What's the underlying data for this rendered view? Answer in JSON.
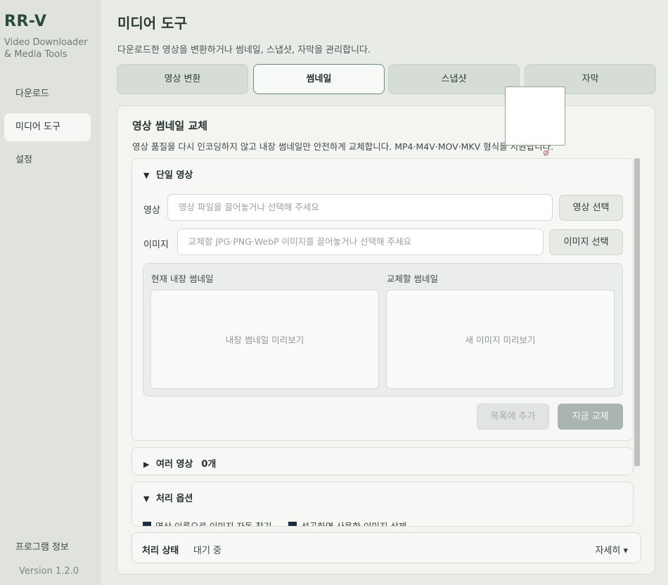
{
  "sidebar": {
    "brand": "RR-V",
    "subtitle_line1": "Video Downloader",
    "subtitle_line2": "& Media Tools",
    "items": [
      {
        "label": "다운로드"
      },
      {
        "label": "미디어 도구"
      },
      {
        "label": "설정"
      }
    ],
    "info": "프로그램 정보",
    "version": "Version 1.2.0"
  },
  "header": {
    "title": "미디어 도구",
    "description": "다운로드한 영상을 변환하거나 썸네일, 스냅샷, 자막을 관리합니다."
  },
  "tabs": [
    {
      "label": "영상 변환"
    },
    {
      "label": "썸네일"
    },
    {
      "label": "스냅샷"
    },
    {
      "label": "자막"
    }
  ],
  "panel": {
    "title": "영상 썸네일 교체",
    "description": "영상 품질을 다시 인코딩하지 않고 내장 썸네일만 안전하게 교체합니다. MP4·M4V·MOV·MKV 형식을 지원합니다."
  },
  "single": {
    "header": "단일 영상",
    "video_label": "영상",
    "video_placeholder": "영상 파일을 끌어놓거나 선택해 주세요",
    "video_button": "영상 선택",
    "image_label": "이미지",
    "image_placeholder": "교체할 JPG·PNG·WebP 이미지를 끌어놓거나 선택해 주세요",
    "image_button": "이미지 선택",
    "current_label": "현재 내장 썸네일",
    "current_preview": "내장 썸네일 미리보기",
    "new_label": "교체할 썸네일",
    "new_preview": "새 이미지 미리보기",
    "add_button": "목록에 추가",
    "apply_button": "지금 교체"
  },
  "multi": {
    "header": "여러 영상",
    "count": "0개"
  },
  "options": {
    "header": "처리 옵션",
    "opt1": "영상 이름으로 이미지 자동 찾기",
    "opt2": "성공하면 사용한 이미지 삭제"
  },
  "status": {
    "label": "처리 상태",
    "value": "대기 중",
    "detail": "자세히 ▾"
  },
  "icons": {
    "expanded": "▼",
    "collapsed": "▶",
    "no_drop": "⊘"
  }
}
